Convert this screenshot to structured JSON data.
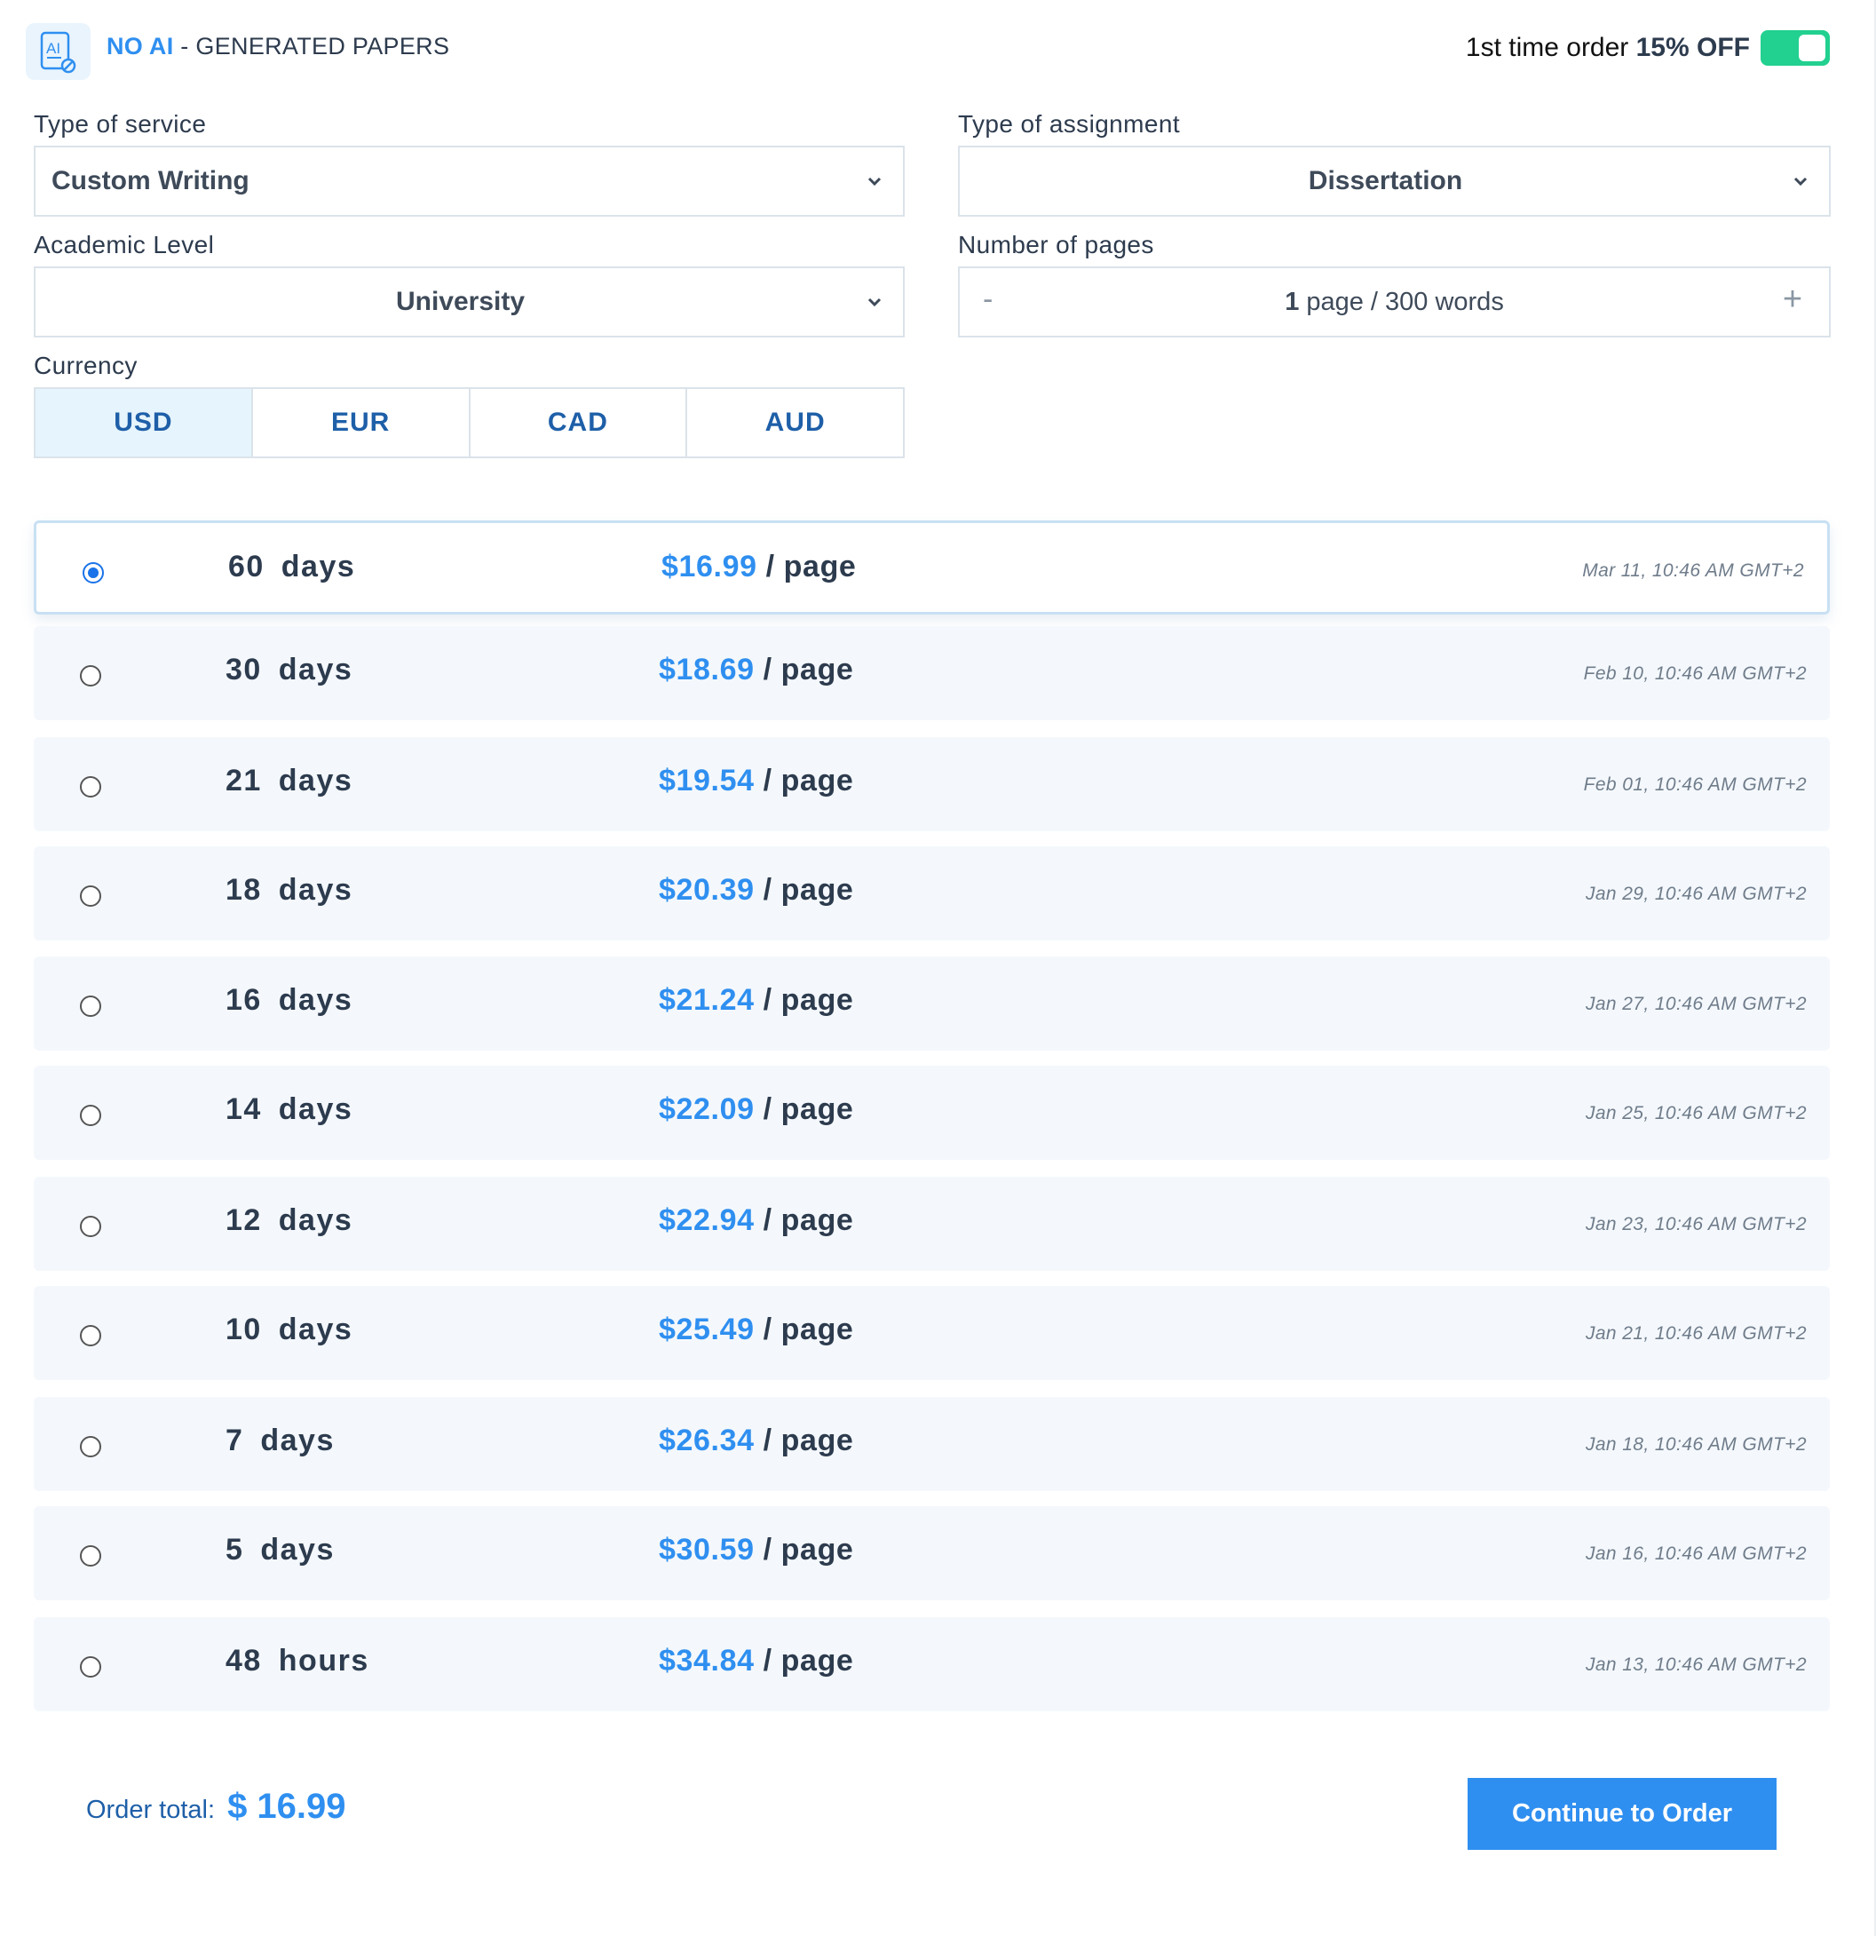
{
  "header": {
    "brand_accent": "NO AI",
    "brand_sep": " - ",
    "brand_rest": "GENERATED PAPERS",
    "promo_prefix": "1st time order ",
    "promo_bold": "15% OFF",
    "promo_enabled": true
  },
  "form": {
    "service_label": "Type of service",
    "service_value": "Custom Writing",
    "assignment_label": "Type of assignment",
    "assignment_value": "Dissertation",
    "level_label": "Academic Level",
    "level_value": "University",
    "pages_label": "Number of pages",
    "pages_count": "1",
    "pages_unit": "page / 300 words",
    "pages_minus": "-",
    "pages_plus": "+",
    "currency_label": "Currency",
    "currencies": [
      "USD",
      "EUR",
      "CAD",
      "AUD"
    ],
    "currency_selected": "USD"
  },
  "deadlines": [
    {
      "num": "60",
      "unit": "days",
      "price": "$16.99",
      "per": "/ page",
      "date": "Mar 11, 10:46 AM GMT+2",
      "selected": true
    },
    {
      "num": "30",
      "unit": "days",
      "price": "$18.69",
      "per": "/ page",
      "date": "Feb 10, 10:46 AM GMT+2",
      "selected": false
    },
    {
      "num": "21",
      "unit": "days",
      "price": "$19.54",
      "per": "/ page",
      "date": "Feb 01, 10:46 AM GMT+2",
      "selected": false
    },
    {
      "num": "18",
      "unit": "days",
      "price": "$20.39",
      "per": "/ page",
      "date": "Jan 29, 10:46 AM GMT+2",
      "selected": false
    },
    {
      "num": "16",
      "unit": "days",
      "price": "$21.24",
      "per": "/ page",
      "date": "Jan 27, 10:46 AM GMT+2",
      "selected": false
    },
    {
      "num": "14",
      "unit": "days",
      "price": "$22.09",
      "per": "/ page",
      "date": "Jan 25, 10:46 AM GMT+2",
      "selected": false
    },
    {
      "num": "12",
      "unit": "days",
      "price": "$22.94",
      "per": "/ page",
      "date": "Jan 23, 10:46 AM GMT+2",
      "selected": false
    },
    {
      "num": "10",
      "unit": "days",
      "price": "$25.49",
      "per": "/ page",
      "date": "Jan 21, 10:46 AM GMT+2",
      "selected": false
    },
    {
      "num": "7",
      "unit": "days",
      "price": "$26.34",
      "per": "/ page",
      "date": "Jan 18, 10:46 AM GMT+2",
      "selected": false
    },
    {
      "num": "5",
      "unit": "days",
      "price": "$30.59",
      "per": "/ page",
      "date": "Jan 16, 10:46 AM GMT+2",
      "selected": false
    },
    {
      "num": "48",
      "unit": "hours",
      "price": "$34.84",
      "per": "/ page",
      "date": "Jan 13, 10:46 AM GMT+2",
      "selected": false
    }
  ],
  "footer": {
    "total_label": "Order total:",
    "total_value": "$ 16.99",
    "continue_label": "Continue to Order"
  },
  "colors": {
    "accent": "#2f8ff0",
    "toggle_on": "#22d08f",
    "row_bg": "#f4f8fc",
    "currency_active_bg": "#e6f4fd",
    "currency_text": "#1e5fa8"
  },
  "icons": {
    "logo": "ai-document-icon",
    "dropdown": "chevron-down-icon"
  }
}
